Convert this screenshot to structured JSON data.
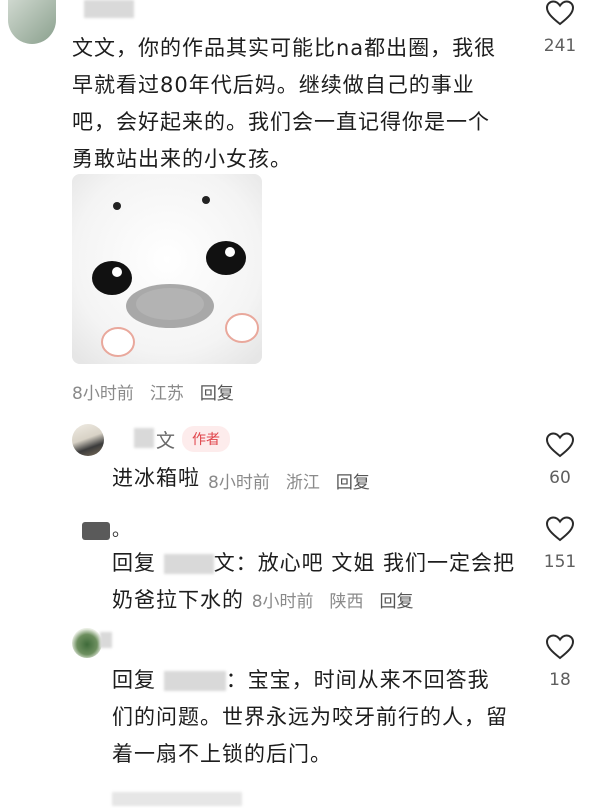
{
  "comment1": {
    "text": "文文，你的作品其实可能比na都出圈，我很早就看过80年代后妈。继续做自己的事业吧，会好起来的。我们会一直记得你是一个勇敢站出来的小女孩。",
    "lines": [
      "文文，你的作品其实可能比na都出圈，我很",
      "早就看过80年代后妈。继续做自己的事业",
      "吧，会好起来的。我们会一直记得你是一个",
      "勇敢站出来的小女孩。"
    ],
    "time": "8小时前",
    "location": "江苏",
    "reply_label": "回复",
    "likes": "241",
    "image_icon": "seal-sticker"
  },
  "reply1": {
    "username_visible": "文",
    "badge": "作者",
    "text": "进冰箱啦",
    "time": "8小时前",
    "location": "浙江",
    "reply_label": "回复",
    "likes": "60"
  },
  "reply2": {
    "username_visible": "。",
    "prefix": "回复",
    "target_visible": "文：",
    "lines": [
      "放心吧 文姐 我们一定会把",
      "奶爸拉下水的"
    ],
    "time": "8小时前",
    "location": "陕西",
    "reply_label": "回复",
    "likes": "151"
  },
  "reply3": {
    "prefix": "回复",
    "target_visible": "：",
    "lines": [
      "宝宝，时间从来不回答我",
      "们的问题。世界永远为咬牙前行的人，留",
      "着一扇不上锁的后门。"
    ],
    "likes": "18"
  },
  "colors": {
    "badge_bg": "#fdecec",
    "badge_text": "#e0454b",
    "meta": "#8a8a8a"
  },
  "icons": {
    "like": "heart-outline-icon"
  }
}
